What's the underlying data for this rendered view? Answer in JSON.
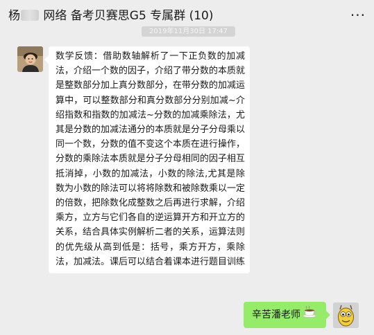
{
  "header": {
    "title_prefix": "杨",
    "title_suffix": "网络 备考贝赛思G5 专属群 (10)",
    "more_icon": "more-dots-icon"
  },
  "timestamp": "2019年11月30日 17:47",
  "messages": [
    {
      "side": "left",
      "avatar": "avatar-child-photo",
      "text": "数学反馈：借助数轴解析了一下正负数的加减法，介绍一个数的因子，介绍了带分数的本质就是整数部分加上真分数部分，在带分数的加减运算中，可以整数部分和真分数部分分别加减~介绍指数和指数的加减法~分数的加减乘除法，尤其是分数的加减法通分的本质就是分子分母乘以同一个数，分数的值不变这个本质在进行操作，分数的乘除法本质就是分子分母相同的因子相互抵消掉，小数的加减法，小数的除法,尤其是除数为小数的除法可以将将除数和被除数乘以一定的倍数，把除数化成整数之后再进行求解，介绍乘方，立方与它们各自的逆运算开方和开立方的关系，结合具体实例解析二者的关系，运算法则的优先级从高到低是：括号，乘方开方，乘除法，加减法。课后可以结合着课本进行题目训练"
    },
    {
      "side": "right",
      "avatar": "avatar-cartoon",
      "text": "辛苦潘老师",
      "emoji": "coffee-icon"
    }
  ]
}
